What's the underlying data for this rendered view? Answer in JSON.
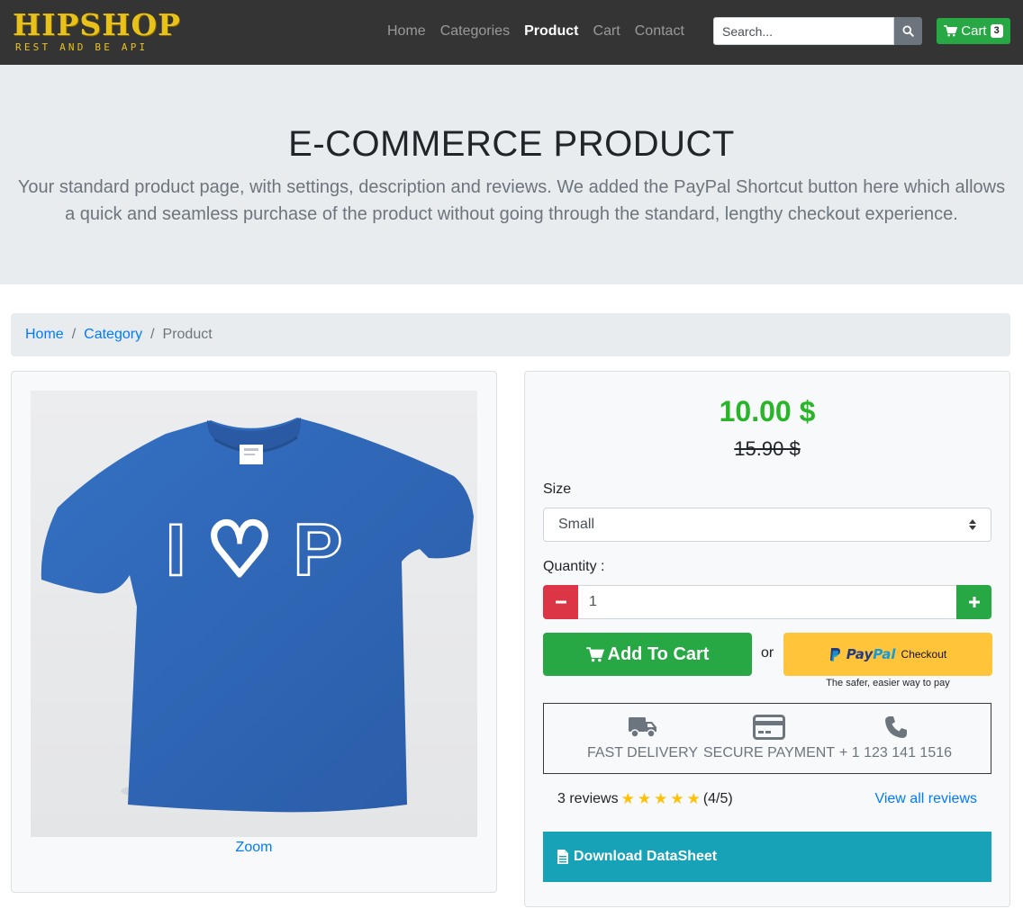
{
  "brand": {
    "title": "HIPSHOP",
    "subtitle": "REST AND BE API"
  },
  "nav": {
    "items": [
      {
        "label": "Home"
      },
      {
        "label": "Categories"
      },
      {
        "label": "Product"
      },
      {
        "label": "Cart"
      },
      {
        "label": "Contact"
      }
    ],
    "active": "Product"
  },
  "search": {
    "placeholder": "Search...",
    "icon": "search-icon"
  },
  "cart": {
    "label": "Cart",
    "count": "3",
    "icon": "shopping-cart-icon"
  },
  "jumbotron": {
    "title": "E-COMMERCE PRODUCT",
    "description": "Your standard product page, with settings, description and reviews. We added the PayPal Shortcut button here which allows a quick and seamless purchase of the product without going through the standard, lengthy checkout experience."
  },
  "breadcrumb": {
    "items": [
      "Home",
      "Category"
    ],
    "current": "Product"
  },
  "product": {
    "zoom_label": "Zoom",
    "shirt_print": "I ♡ P",
    "price": "10.00 $",
    "old_price": "15.90 $",
    "size_label": "Size",
    "size_value": "Small",
    "quantity_label": "Quantity :",
    "quantity_value": "1",
    "add_to_cart_label": "Add To Cart",
    "or_label": "or",
    "paypal": {
      "pay": "Pay",
      "pal": "Pal",
      "checkout": "Checkout",
      "tagline": "The safer, easier way to pay"
    },
    "features": [
      {
        "label": "FAST DELIVERY",
        "icon": "truck-icon"
      },
      {
        "label": "SECURE PAYMENT",
        "icon": "credit-card-icon"
      },
      {
        "label": "+ 1 123 141 1516",
        "icon": "phone-icon"
      }
    ],
    "reviews": {
      "count_label": "3 reviews",
      "rating_label": "(4/5)",
      "stars": 5,
      "view_all_label": "View all reviews"
    },
    "datasheet_label": "Download DataSheet"
  },
  "colors": {
    "navbar": "#343434",
    "accent_green": "#28a745",
    "price_green": "#28b528",
    "danger": "#dc3545",
    "info": "#17a2b8",
    "link": "#007bff",
    "paypal_yellow": "#ffc439",
    "shirt_blue": "#2e64b4"
  }
}
